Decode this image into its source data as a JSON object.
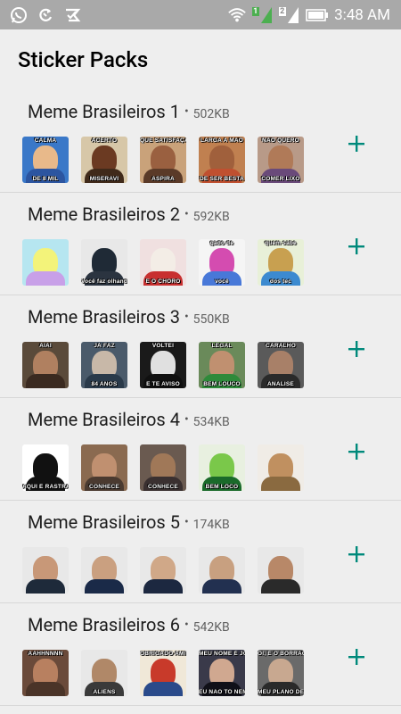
{
  "status_bar": {
    "time": "3:48 AM",
    "sim_badges": [
      "1",
      "2"
    ],
    "icons": [
      "whatsapp-icon",
      "sync-icon",
      "checklist-icon",
      "wifi-icon",
      "signal-1-icon",
      "signal-2-icon",
      "battery-icon"
    ]
  },
  "header": {
    "title": "Sticker Packs"
  },
  "colors": {
    "accent": "#00897b",
    "background": "#eeeeee",
    "divider": "#d7d7d7"
  },
  "packs": [
    {
      "name": "Meme Brasileiros 1",
      "dot": "•",
      "size": "502KB",
      "stickers": [
        {
          "top": "CALMA",
          "bottom": "DE 8 MIL",
          "bg": "#3a78c8",
          "face": "#e8b98a",
          "body": "#2c55a0"
        },
        {
          "top": "ACERTO",
          "bottom": "MISERAVI",
          "bg": "#d7c7a8",
          "face": "#6b3a22",
          "body": "#402a1a"
        },
        {
          "top": "QUE SATISFAÇÃO",
          "bottom": "ASPIRA",
          "bg": "#c9a27a",
          "face": "#9a6040",
          "body": "#5a3a28"
        },
        {
          "top": "LARGA A MÃO",
          "bottom": "DE SER BESTA",
          "bg": "#c08050",
          "face": "#a0603c",
          "body": "#c05030"
        },
        {
          "top": "NÃO QUERO",
          "bottom": "COMER LIXO",
          "bg": "#b89a88",
          "face": "#b07a58",
          "body": "#6a4a7a"
        }
      ]
    },
    {
      "name": "Meme Brasileiros 2",
      "dot": "•",
      "size": "592KB",
      "stickers": [
        {
          "top": "",
          "bottom": "",
          "bg": "#b6e6f0",
          "face": "#f3f37a",
          "body": "#c8a0e8"
        },
        {
          "top": "",
          "bottom": "Você faz olhando pra",
          "bg": "#e8e8e8",
          "face": "#1f2a36",
          "body": "#2b3440"
        },
        {
          "top": "",
          "bottom": "E O CHORO",
          "bg": "#f0e0e0",
          "face": "#f3ede6",
          "body": "#c83030"
        },
        {
          "top": "gado de",
          "bottom": "você",
          "bg": "#f5f5f5",
          "face": "#d44cb0",
          "body": "#4878d8"
        },
        {
          "top": "quem sabe",
          "bottom": "dos tec",
          "bg": "#e8f0d8",
          "face": "#c8a050",
          "body": "#3c8ad0"
        }
      ]
    },
    {
      "name": "Meme Brasileiros 3",
      "dot": "•",
      "size": "550KB",
      "stickers": [
        {
          "top": "AIAI",
          "bottom": "",
          "bg": "#5a4a3a",
          "face": "#b08060",
          "body": "#3a2a20"
        },
        {
          "top": "JÁ FAZ",
          "bottom": "84 ANOS",
          "bg": "#4a5a6a",
          "face": "#c8b8a8",
          "body": "#2a3a4a"
        },
        {
          "top": "VOLTEI",
          "bottom": "E TE AVISO",
          "bg": "#1a1a1a",
          "face": "#e0e0e0",
          "body": "#101010"
        },
        {
          "top": "LEGAL",
          "bottom": "BEM LOUCO",
          "bg": "#6a8a5a",
          "face": "#c09070",
          "body": "#2e8a3a"
        },
        {
          "top": "CARALHO",
          "bottom": "ANALISE",
          "bg": "#5a5a5a",
          "face": "#a88068",
          "body": "#2a2a2a"
        }
      ]
    },
    {
      "name": "Meme Brasileiros 4",
      "dot": "•",
      "size": "534KB",
      "stickers": [
        {
          "top": "",
          "bottom": "AQUI É RASTRADO",
          "bg": "#ffffff",
          "face": "#111111",
          "body": "#111111"
        },
        {
          "top": "",
          "bottom": "CONHECE",
          "bg": "#8a6a50",
          "face": "#c09070",
          "body": "#4a3a30"
        },
        {
          "top": "",
          "bottom": "CONHECE",
          "bg": "#6a5a50",
          "face": "#a07858",
          "body": "#3a3030"
        },
        {
          "top": "",
          "bottom": "BEM LOCO",
          "bg": "#e8f0e0",
          "face": "#7ac84a",
          "body": "#1a6a2a"
        },
        {
          "top": "",
          "bottom": "",
          "bg": "#f0ece6",
          "face": "#c09060",
          "body": "#8a6a40"
        }
      ]
    },
    {
      "name": "Meme Brasileiros 5",
      "dot": "•",
      "size": "174KB",
      "stickers": [
        {
          "top": "",
          "bottom": "",
          "bg": "#e8e8e8",
          "face": "#c89878",
          "body": "#1e2a3a"
        },
        {
          "top": "",
          "bottom": "",
          "bg": "#e8e8e8",
          "face": "#caa080",
          "body": "#1a2a48"
        },
        {
          "top": "",
          "bottom": "",
          "bg": "#e8e8e8",
          "face": "#d0a888",
          "body": "#1c2840"
        },
        {
          "top": "",
          "bottom": "",
          "bg": "#e8e8e8",
          "face": "#c8a080",
          "body": "#223050"
        },
        {
          "top": "",
          "bottom": "",
          "bg": "#e8e8e8",
          "face": "#b88868",
          "body": "#2a2a2a"
        }
      ]
    },
    {
      "name": "Meme Brasileiros 6",
      "dot": "•",
      "size": "542KB",
      "stickers": [
        {
          "top": "AAHHNNNN",
          "bottom": "",
          "bg": "#6a4a3a",
          "face": "#b88060",
          "body": "#4a3428"
        },
        {
          "top": "",
          "bottom": "ALIENS",
          "bg": "#e8e8e8",
          "face": "#b08868",
          "body": "#3a3a3a"
        },
        {
          "top": "OBRIGADO AMIGO",
          "bottom": "",
          "bg": "#f0e8d8",
          "face": "#c83a2a",
          "body": "#2a4a8a"
        },
        {
          "top": "MEU NOME É JOH",
          "bottom": "EU NÃO TO NEM AÍ",
          "bg": "#3a3a4a",
          "face": "#d0a890",
          "body": "#101018"
        },
        {
          "top": "OI, É O BORRÃO",
          "bottom": "MEU PLANO DEU ERRADO",
          "bg": "#6a6a6a",
          "face": "#c8a890",
          "body": "#2a2a2a"
        }
      ]
    }
  ]
}
